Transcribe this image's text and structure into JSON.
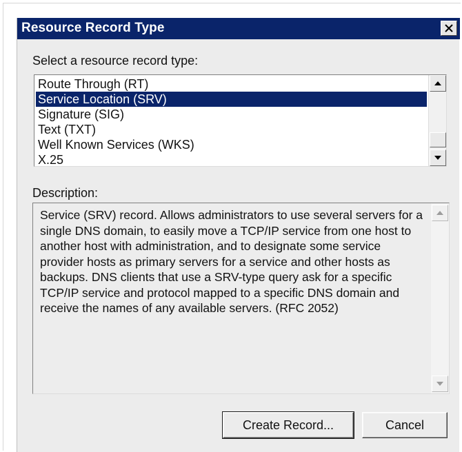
{
  "dialog": {
    "title": "Resource Record Type"
  },
  "record_type_label": "Select a resource record type:",
  "record_types": [
    {
      "label": "Route Through (RT)",
      "selected": false
    },
    {
      "label": "Service Location (SRV)",
      "selected": true
    },
    {
      "label": "Signature (SIG)",
      "selected": false
    },
    {
      "label": "Text (TXT)",
      "selected": false
    },
    {
      "label": "Well Known Services (WKS)",
      "selected": false
    },
    {
      "label": "X.25",
      "selected": false
    }
  ],
  "description_label": "Description:",
  "description_text": "Service (SRV) record. Allows administrators to use several servers for a single DNS domain, to easily move a TCP/IP service from one host to another host with administration, and to designate some service provider hosts as primary servers for a service and other hosts as backups. DNS clients that use a SRV-type query ask for a specific TCP/IP service and protocol mapped to a specific DNS domain and receive the names of any available servers. (RFC 2052)",
  "buttons": {
    "create_record": "Create Record...",
    "cancel": "Cancel"
  },
  "icons": {
    "close": "close-icon",
    "scroll_up": "arrow-up-icon",
    "scroll_down": "arrow-down-icon"
  },
  "colors": {
    "titlebar": "#0a246a",
    "selection": "#0a246a",
    "dialog_face": "#ececec"
  }
}
